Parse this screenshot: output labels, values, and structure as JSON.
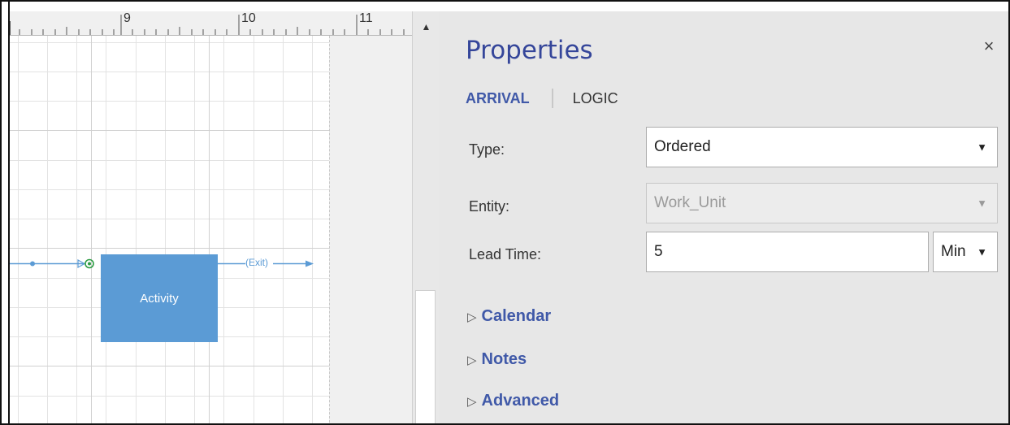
{
  "ruler": {
    "labels": [
      "9",
      "10",
      "11"
    ]
  },
  "diagram": {
    "activity_label": "Activity",
    "exit_label": "(Exit)"
  },
  "scrollbar": {
    "up_arrow": "▲"
  },
  "panel": {
    "title": "Properties",
    "close_icon": "×",
    "tabs": [
      {
        "label": "ARRIVAL",
        "active": true
      },
      {
        "label": "LOGIC",
        "active": false
      }
    ],
    "fields": {
      "type": {
        "label": "Type:",
        "value": "Ordered"
      },
      "entity": {
        "label": "Entity:",
        "value": "Work_Unit"
      },
      "lead_time": {
        "label": "Lead Time:",
        "value": "5",
        "unit": "Min"
      }
    },
    "sections": [
      {
        "label": "Calendar"
      },
      {
        "label": "Notes"
      },
      {
        "label": "Advanced"
      }
    ]
  },
  "colors": {
    "accent": "#4059a8",
    "activity_fill": "#5b9bd5",
    "connector": "#5b9bd5"
  }
}
